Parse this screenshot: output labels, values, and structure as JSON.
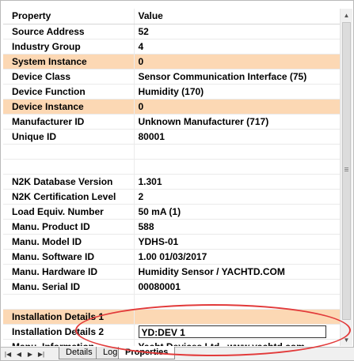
{
  "header": {
    "property": "Property",
    "value": "Value"
  },
  "rows": [
    {
      "property": "Source Address",
      "value": "52",
      "highlight": false
    },
    {
      "property": "Industry Group",
      "value": "4",
      "highlight": false
    },
    {
      "property": "System Instance",
      "value": "0",
      "highlight": true
    },
    {
      "property": "Device Class",
      "value": "Sensor Communication Interface (75)",
      "highlight": false
    },
    {
      "property": "Device Function",
      "value": "Humidity (170)",
      "highlight": false
    },
    {
      "property": "Device Instance",
      "value": "0",
      "highlight": true
    },
    {
      "property": "Manufacturer ID",
      "value": "Unknown Manufacturer (717)",
      "highlight": false
    },
    {
      "property": "Unique ID",
      "value": "80001",
      "highlight": false
    },
    {
      "property": "",
      "value": "",
      "highlight": false
    },
    {
      "property": "",
      "value": "",
      "highlight": false
    },
    {
      "property": "N2K Database Version",
      "value": "1.301",
      "highlight": false
    },
    {
      "property": "N2K Certification Level",
      "value": "2",
      "highlight": false
    },
    {
      "property": "Load Equiv. Number",
      "value": "50 mA (1)",
      "highlight": false
    },
    {
      "property": "Manu. Product ID",
      "value": "588",
      "highlight": false
    },
    {
      "property": "Manu. Model ID",
      "value": "YDHS-01",
      "highlight": false
    },
    {
      "property": "Manu. Software ID",
      "value": "1.00 01/03/2017",
      "highlight": false
    },
    {
      "property": "Manu. Hardware ID",
      "value": "Humidity Sensor / YACHTD.COM",
      "highlight": false
    },
    {
      "property": "Manu. Serial ID",
      "value": "00080001",
      "highlight": false
    },
    {
      "property": "",
      "value": "",
      "highlight": false
    },
    {
      "property": "Installation Details 1",
      "value": "",
      "highlight": true
    },
    {
      "property": "Installation Details 2",
      "value": "YD:DEV 1",
      "highlight": false,
      "editing": true
    },
    {
      "property": "Manu. Information",
      "value": "Yacht Devices Ltd., www.yachtd.com",
      "highlight": false
    }
  ],
  "tabs": {
    "details": "Details",
    "log": "Log",
    "properties": "Properties"
  },
  "colors": {
    "highlight": "#fcd8b4",
    "annotation": "#e23a3a"
  }
}
